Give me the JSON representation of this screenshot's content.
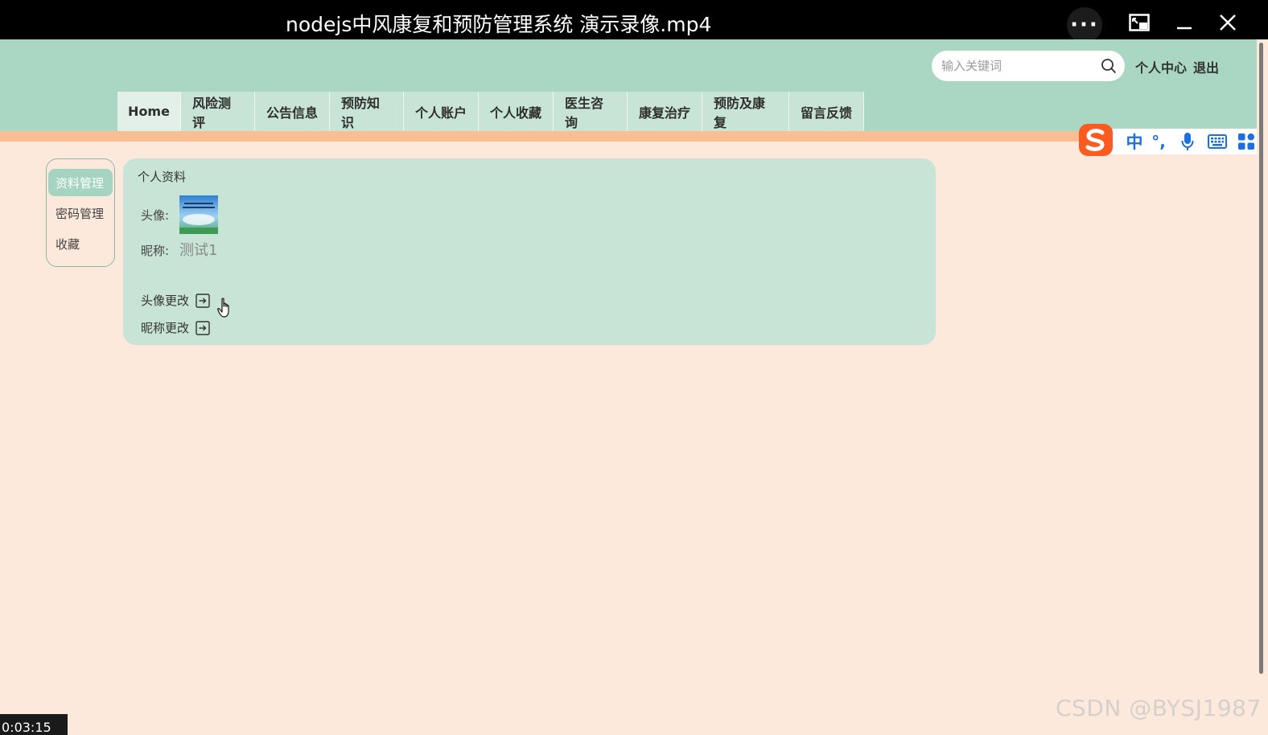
{
  "player": {
    "title": "nodejs中风康复和预防管理系统 演示录像.mp4",
    "more_label": "···",
    "timestamp": "0:03:15"
  },
  "header": {
    "search_placeholder": "输入关键词",
    "user_center": "个人中心",
    "logout": "退出"
  },
  "nav": {
    "items": [
      "Home",
      "风险测评",
      "公告信息",
      "预防知识",
      "个人账户",
      "个人收藏",
      "医生咨询",
      "康复治疗",
      "预防及康复",
      "留言反馈"
    ]
  },
  "ime": {
    "lang": "中",
    "punct": "°,"
  },
  "sidebar": {
    "items": [
      {
        "label": "资料管理",
        "active": true
      },
      {
        "label": "密码管理",
        "active": false
      },
      {
        "label": "收藏",
        "active": false
      }
    ]
  },
  "profile": {
    "title": "个人资料",
    "avatar_label": "头像:",
    "nickname_label": "昵称:",
    "nickname_value": "测试1",
    "change_avatar": "头像更改",
    "change_nickname": "昵称更改"
  },
  "watermark": "CSDN @BYSJ1987",
  "colors": {
    "header_bg": "#a9d7c3",
    "accent_stripe": "#f9be92",
    "page_bg": "#fde9dc",
    "card_bg": "#c8e4d6",
    "ime_blue": "#1d6fe0"
  }
}
